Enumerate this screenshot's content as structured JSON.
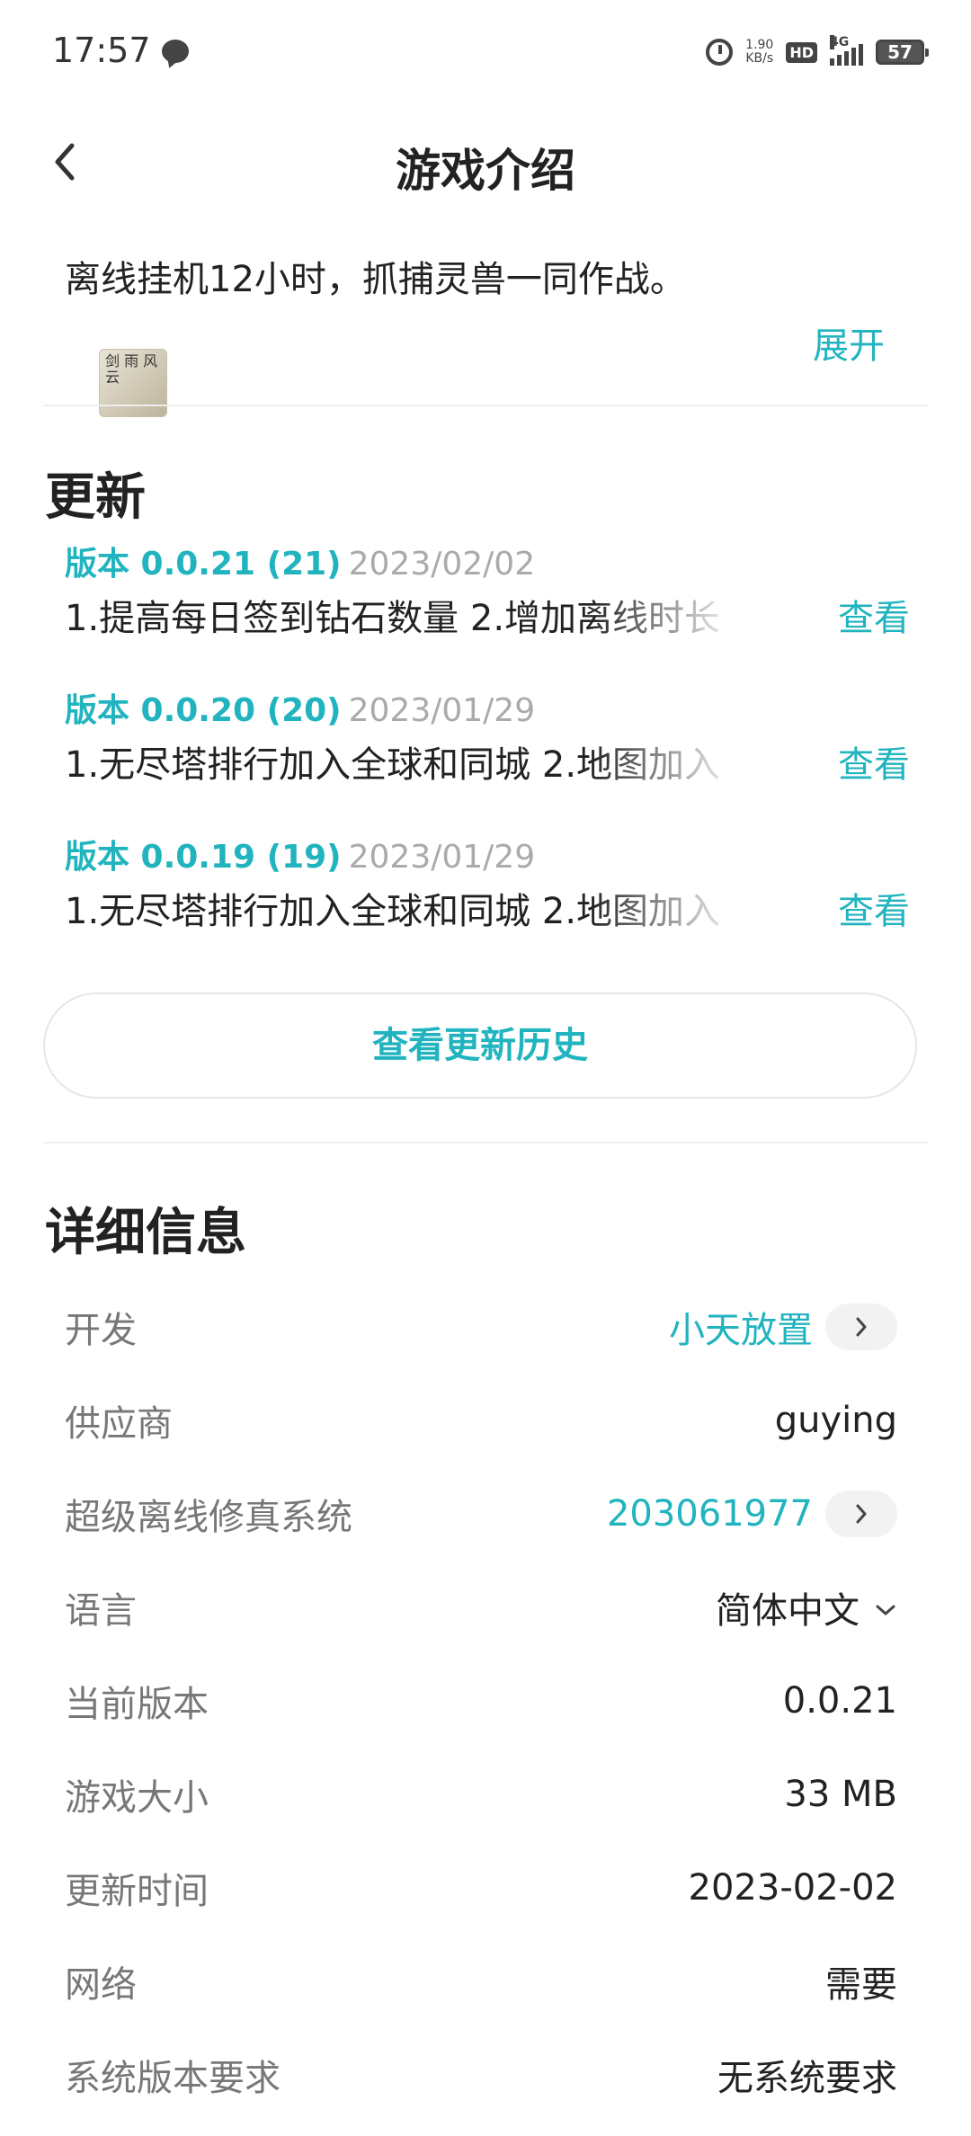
{
  "status_bar": {
    "time": "17:57",
    "net_speed_value": "1.90",
    "net_speed_unit": "KB/s",
    "hd_label": "HD",
    "signal_label": "4G",
    "battery": "57"
  },
  "header": {
    "title": "游戏介绍"
  },
  "intro": {
    "text": "离线挂机12小时，抓捕灵兽一同作战。",
    "expand_label": "展开",
    "thumbnail_text": "剑 雨 风 云"
  },
  "updates": {
    "section_title": "更新",
    "items": [
      {
        "version": "版本 0.0.21 (21)",
        "date": "2023/02/02",
        "description": "1.提高每日签到钻石数量 2.增加离线时长",
        "view_label": "查看"
      },
      {
        "version": "版本 0.0.20 (20)",
        "date": "2023/01/29",
        "description": "1.无尽塔排行加入全球和同城 2.地图加入",
        "view_label": "查看"
      },
      {
        "version": "版本 0.0.19 (19)",
        "date": "2023/01/29",
        "description": "1.无尽塔排行加入全球和同城 2.地图加入",
        "view_label": "查看"
      }
    ],
    "history_button": "查看更新历史"
  },
  "details": {
    "section_title": "详细信息",
    "developer": {
      "label": "开发",
      "value": "小天放置"
    },
    "supplier": {
      "label": "供应商",
      "value": "guying"
    },
    "group": {
      "label": "超级离线修真系统",
      "value": "203061977"
    },
    "language": {
      "label": "语言",
      "value": "简体中文"
    },
    "current_version": {
      "label": "当前版本",
      "value": "0.0.21"
    },
    "game_size": {
      "label": "游戏大小",
      "value": "33 MB"
    },
    "update_time": {
      "label": "更新时间",
      "value": "2023-02-02"
    },
    "network": {
      "label": "网络",
      "value": "需要"
    },
    "system_requirement": {
      "label": "系统版本要求",
      "value": "无系统要求"
    }
  },
  "colors": {
    "accent": "#21b4bf",
    "muted_text": "#777777",
    "date_text": "#aaaaaa",
    "divider": "#eeeeee"
  }
}
